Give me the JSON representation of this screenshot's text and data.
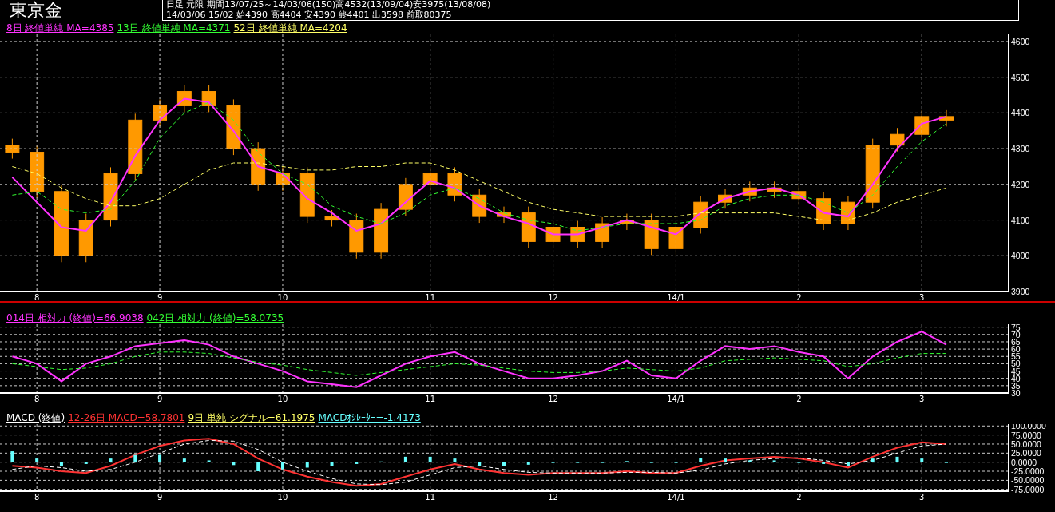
{
  "title": "東京金",
  "info": {
    "line_1": "日足 元限 期間13/07/25～14/03/06(150)高4532(13/09/04)安3975(13/08/08)",
    "line_2": "14/03/06 15/02 始4390 高4404 安4390 終4401 出3598 前取80375"
  },
  "panels": [
    {
      "legend": [
        {
          "text": "8日 終値単純 MA=4385",
          "color": "#ff33ff"
        },
        {
          "text": "13日 終値単純 MA=4371",
          "color": "#33ff33"
        },
        {
          "text": "52日 終値単純 MA=4204",
          "color": "#ffff66"
        }
      ],
      "chart_data": {
        "type": "line",
        "grid": true,
        "ylim": [
          3900,
          4620
        ],
        "yticks": [
          {
            "value": 4600,
            "label": "4600"
          },
          {
            "value": 4500,
            "label": "4500"
          },
          {
            "value": 4400,
            "label": "4400"
          },
          {
            "value": 4300,
            "label": "4300"
          },
          {
            "value": 4200,
            "label": "4200"
          },
          {
            "value": 4100,
            "label": "4100"
          },
          {
            "value": 4000,
            "label": "4000"
          },
          {
            "value": 3900,
            "label": "3900"
          }
        ],
        "categories": [
          null,
          "8",
          null,
          null,
          null,
          null,
          "9",
          null,
          null,
          null,
          null,
          "10",
          null,
          null,
          null,
          null,
          null,
          "11",
          null,
          null,
          null,
          null,
          "12",
          null,
          null,
          null,
          null,
          "14/1",
          null,
          null,
          null,
          null,
          "2",
          null,
          null,
          null,
          null,
          "3",
          null
        ],
        "series": [
          {
            "color": "#ff33ff",
            "line_style": "solid",
            "values": [
              4220,
              4150,
              4080,
              4070,
              4150,
              4280,
              4380,
              4440,
              4430,
              4350,
              4250,
              4230,
              4160,
              4120,
              4070,
              4090,
              4150,
              4210,
              4190,
              4140,
              4110,
              4090,
              4060,
              4060,
              4080,
              4100,
              4080,
              4060,
              4120,
              4160,
              4180,
              4190,
              4170,
              4120,
              4110,
              4200,
              4300,
              4370,
              4390
            ]
          },
          {
            "color": "#33ff33",
            "line_style": "dashed",
            "values": [
              4170,
              4180,
              4130,
              4120,
              4130,
              4210,
              4330,
              4400,
              4430,
              4380,
              4290,
              4230,
              4200,
              4140,
              4110,
              4090,
              4120,
              4170,
              4190,
              4160,
              4120,
              4100,
              4090,
              4070,
              4080,
              4090,
              4090,
              4090,
              4100,
              4140,
              4160,
              4170,
              4170,
              4150,
              4120,
              4170,
              4250,
              4320,
              4370
            ]
          },
          {
            "color": "#ffff66",
            "line_style": "dashed",
            "values": [
              4250,
              4230,
              4190,
              4160,
              4140,
              4140,
              4160,
              4200,
              4240,
              4260,
              4260,
              4250,
              4240,
              4240,
              4250,
              4250,
              4260,
              4260,
              4240,
              4210,
              4180,
              4150,
              4130,
              4120,
              4110,
              4110,
              4110,
              4110,
              4120,
              4120,
              4120,
              4120,
              4110,
              4100,
              4100,
              4120,
              4150,
              4170,
              4190
            ]
          }
        ]
      }
    },
    {
      "legend": [
        {
          "text": "014日 相対力 (終値)=66.9038",
          "color": "#ff33ff"
        },
        {
          "text": "042日 相対力 (終値)=58.0735",
          "color": "#33ff33"
        }
      ],
      "chart_data": {
        "type": "line",
        "grid": true,
        "ylim": [
          30,
          77
        ],
        "yticks": [
          {
            "value": 75,
            "label": "75"
          },
          {
            "value": 70,
            "label": "70"
          },
          {
            "value": 65,
            "label": "65"
          },
          {
            "value": 60,
            "label": "60"
          },
          {
            "value": 55,
            "label": "55"
          },
          {
            "value": 50,
            "label": "50"
          },
          {
            "value": 45,
            "label": "45"
          },
          {
            "value": 40,
            "label": "40"
          },
          {
            "value": 35,
            "label": "35"
          },
          {
            "value": 30,
            "label": "30"
          }
        ],
        "categories": [
          null,
          "8",
          null,
          null,
          null,
          null,
          "9",
          null,
          null,
          null,
          null,
          "10",
          null,
          null,
          null,
          null,
          null,
          "11",
          null,
          null,
          null,
          null,
          "12",
          null,
          null,
          null,
          null,
          "14/1",
          null,
          null,
          null,
          null,
          "2",
          null,
          null,
          null,
          null,
          "3",
          null
        ],
        "series": [
          {
            "color": "#ff33ff",
            "line_style": "solid",
            "values": [
              55,
              50,
              38,
              50,
              55,
              62,
              64,
              66,
              63,
              55,
              50,
              45,
              38,
              36,
              34,
              42,
              50,
              55,
              58,
              50,
              45,
              40,
              40,
              42,
              45,
              52,
              42,
              40,
              52,
              62,
              60,
              62,
              58,
              55,
              40,
              55,
              65,
              72,
              63
            ]
          },
          {
            "color": "#33ff33",
            "line_style": "dashed",
            "values": [
              50,
              48,
              46,
              47,
              50,
              55,
              58,
              58,
              57,
              54,
              51,
              49,
              46,
              44,
              42,
              44,
              46,
              48,
              50,
              49,
              47,
              45,
              44,
              44,
              45,
              47,
              46,
              45,
              47,
              52,
              53,
              54,
              53,
              52,
              48,
              50,
              54,
              57,
              57
            ]
          }
        ]
      }
    },
    {
      "legend": [
        {
          "text": "MACD (終値)",
          "color": "#ffffff"
        },
        {
          "text": "12-26日 MACD=58.7801",
          "color": "#ff3333"
        },
        {
          "text": "9日 単純 シグナル=61.1975",
          "color": "#ffff66"
        },
        {
          "text": "MACDｵｼﾚｰﾀｰ=-1.4173",
          "color": "#66ffff"
        }
      ],
      "chart_data": {
        "type": "line",
        "grid": true,
        "ylim": [
          -80,
          105
        ],
        "yticks": [
          {
            "value": 100,
            "label": "100.0000"
          },
          {
            "value": 75,
            "label": "75.0000"
          },
          {
            "value": 50,
            "label": "50.0000"
          },
          {
            "value": 25,
            "label": "25.0000"
          },
          {
            "value": 0,
            "label": "0.0000"
          },
          {
            "value": -25,
            "label": "-25.0000"
          },
          {
            "value": -50,
            "label": "-50.0000"
          },
          {
            "value": -75,
            "label": "-75.0000"
          }
        ],
        "categories": [
          null,
          "8",
          null,
          null,
          null,
          null,
          "9",
          null,
          null,
          null,
          null,
          "10",
          null,
          null,
          null,
          null,
          null,
          "11",
          null,
          null,
          null,
          null,
          "12",
          null,
          null,
          null,
          null,
          "14/1",
          null,
          null,
          null,
          null,
          "2",
          null,
          null,
          null,
          null,
          "3",
          null
        ],
        "series": [
          {
            "color": "#66ffff",
            "type": "bar",
            "values": [
              30,
              10,
              -10,
              -5,
              10,
              20,
              20,
              10,
              5,
              -8,
              -25,
              -20,
              -15,
              -10,
              -5,
              2,
              15,
              15,
              10,
              -10,
              -10,
              -7,
              0,
              0,
              0,
              3,
              -2,
              0,
              12,
              10,
              5,
              5,
              -2,
              -5,
              -10,
              10,
              15,
              10,
              0
            ]
          },
          {
            "color": "#ff3333",
            "line_style": "solid",
            "values": [
              -10,
              -15,
              -25,
              -30,
              -10,
              20,
              45,
              60,
              65,
              50,
              10,
              -20,
              -40,
              -55,
              -65,
              -60,
              -40,
              -20,
              -5,
              -20,
              -30,
              -35,
              -30,
              -30,
              -30,
              -25,
              -30,
              -30,
              -10,
              5,
              10,
              15,
              10,
              0,
              -15,
              15,
              40,
              55,
              50
            ]
          },
          {
            "color": "#ffffff",
            "line_style": "dashed",
            "values": [
              -20,
              -10,
              -15,
              -25,
              -20,
              0,
              25,
              50,
              60,
              58,
              35,
              0,
              -25,
              -45,
              -60,
              -62,
              -55,
              -35,
              -15,
              -10,
              -20,
              -28,
              -30,
              -30,
              -30,
              -28,
              -28,
              -30,
              -22,
              -5,
              5,
              10,
              12,
              5,
              -5,
              5,
              25,
              45,
              50
            ]
          }
        ]
      }
    }
  ]
}
